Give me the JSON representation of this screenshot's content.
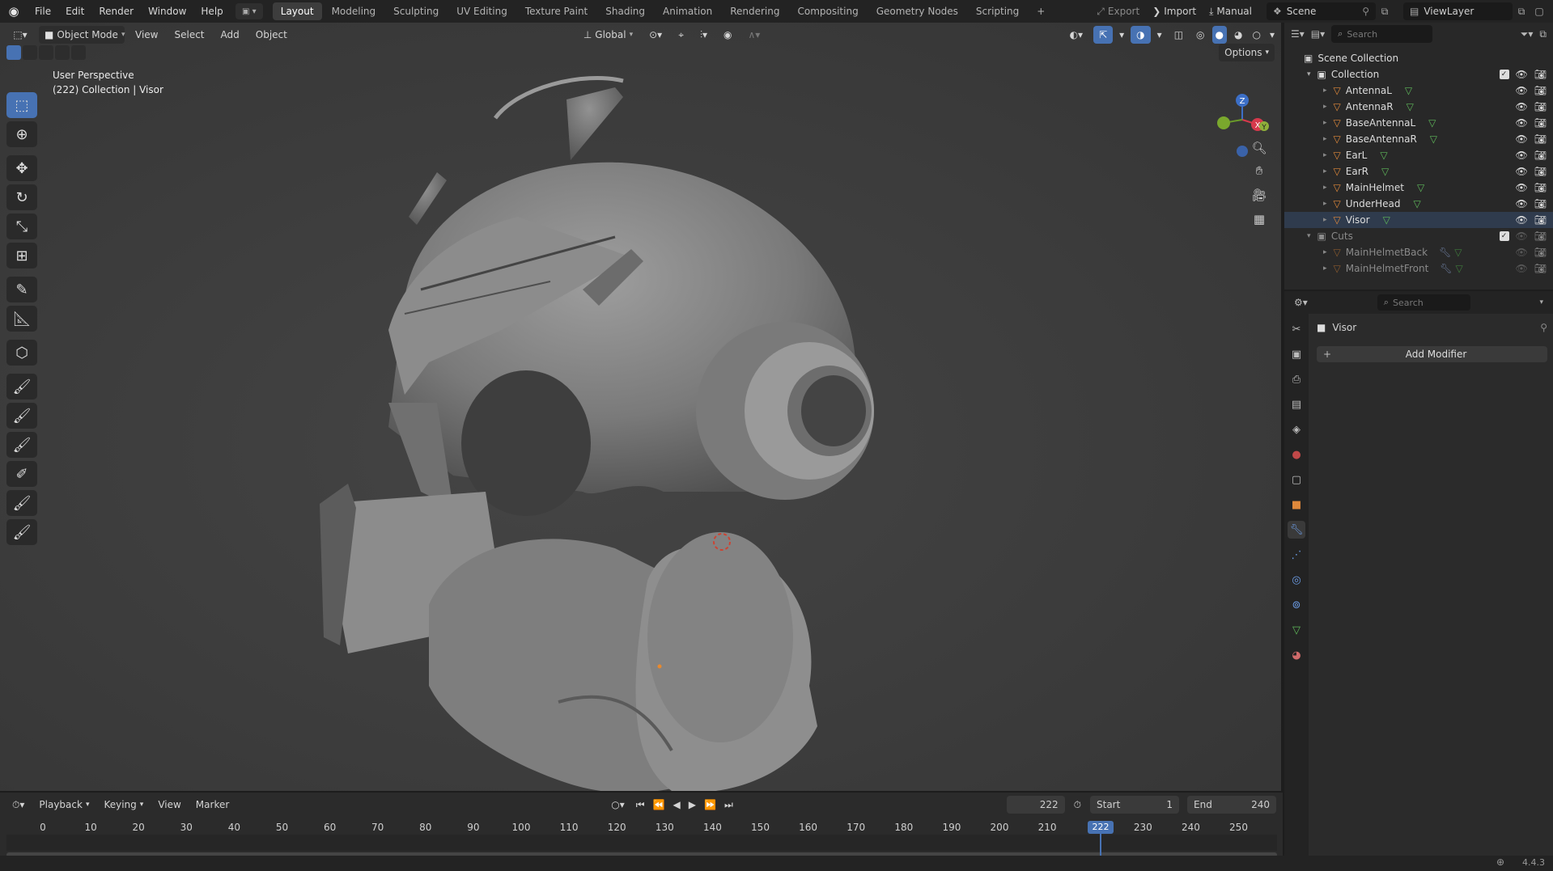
{
  "app": {
    "menu": [
      "File",
      "Edit",
      "Render",
      "Window",
      "Help"
    ],
    "workspaces": [
      "Layout",
      "Modeling",
      "Sculpting",
      "UV Editing",
      "Texture Paint",
      "Shading",
      "Animation",
      "Rendering",
      "Compositing",
      "Geometry Nodes",
      "Scripting"
    ],
    "active_workspace": "Layout",
    "add_tab_label": "+",
    "export_label": "Export",
    "import_label": "Import",
    "manual_label": "Manual",
    "scene_label": "Scene",
    "viewlayer_label": "ViewLayer",
    "accent_color": "#4772b3"
  },
  "viewport": {
    "mode_label": "Object Mode",
    "menus": [
      "View",
      "Select",
      "Add",
      "Object"
    ],
    "transform_orientation": "Global",
    "options_label": "Options",
    "perspective_label": "User Perspective",
    "context_label": "(222) Collection | Visor",
    "gizmo": {
      "z": "Z",
      "x": "X",
      "y": "Y"
    }
  },
  "outliner": {
    "search_placeholder": "Search",
    "scene_collection": "Scene Collection",
    "collection": "Collection",
    "objects": [
      "AntennaL",
      "AntennaR",
      "BaseAntennaL",
      "BaseAntennaR",
      "EarL",
      "EarR",
      "MainHelmet",
      "UnderHead",
      "Visor"
    ],
    "cuts_collection": "Cuts",
    "cut_objects": [
      "MainHelmetBack",
      "MainHelmetFront"
    ]
  },
  "properties": {
    "search_placeholder": "Search",
    "object_name": "Visor",
    "add_modifier_label": "Add Modifier"
  },
  "timeline": {
    "menus": [
      "Playback",
      "Keying",
      "View",
      "Marker"
    ],
    "current_frame": "222",
    "start_label": "Start",
    "start_value": "1",
    "end_label": "End",
    "end_value": "240",
    "frame_marks": [
      "0",
      "10",
      "20",
      "30",
      "40",
      "50",
      "60",
      "70",
      "80",
      "90",
      "100",
      "110",
      "120",
      "130",
      "140",
      "150",
      "160",
      "170",
      "180",
      "190",
      "200",
      "210",
      "2",
      "230",
      "240",
      "250"
    ],
    "playhead_label": "222"
  },
  "status": {
    "version": "4.4.3"
  }
}
